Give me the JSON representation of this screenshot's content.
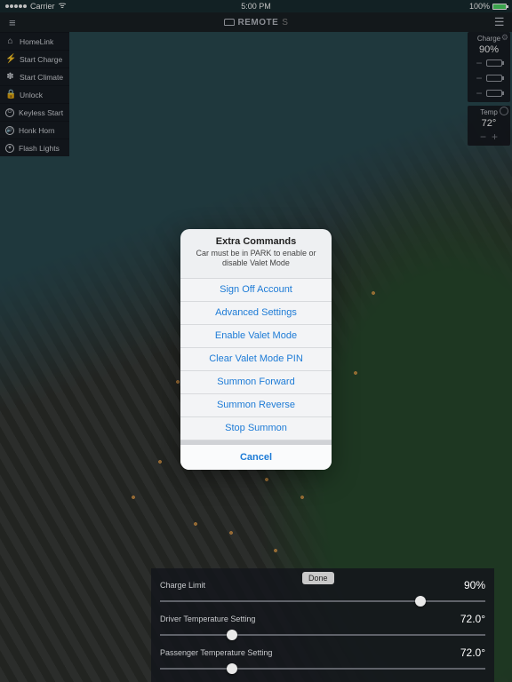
{
  "status_bar": {
    "carrier": "Carrier",
    "time": "5:00 PM",
    "battery_pct": "100%"
  },
  "app_bar": {
    "title_brand": "REMOTE",
    "title_suffix": "S"
  },
  "left_actions": [
    {
      "icon": "home-icon",
      "glyph": "⌂",
      "label": "HomeLink"
    },
    {
      "icon": "bolt-icon",
      "glyph": "⚡",
      "label": "Start Charge"
    },
    {
      "icon": "fan-icon",
      "glyph": "✽",
      "label": "Start Climate"
    },
    {
      "icon": "lock-icon",
      "glyph": "🔒",
      "label": "Unlock"
    },
    {
      "icon": "power-icon",
      "glyph": "⏻",
      "label": "Keyless Start"
    },
    {
      "icon": "horn-icon",
      "glyph": "◉",
      "label": "Honk Horn"
    },
    {
      "icon": "flash-icon",
      "glyph": "◓",
      "label": "Flash Lights"
    }
  ],
  "right_status": {
    "charge_label": "Charge",
    "charge_value": "90%",
    "temp_label": "Temp",
    "temp_value": "72°"
  },
  "action_sheet": {
    "title": "Extra Commands",
    "subtitle": "Car must be in PARK to enable or disable Valet Mode",
    "options": [
      "Sign Off Account",
      "Advanced Settings",
      "Enable Valet Mode",
      "Clear Valet Mode PIN",
      "Summon Forward",
      "Summon Reverse",
      "Stop Summon"
    ],
    "cancel": "Cancel"
  },
  "bottom_panel": {
    "done": "Done",
    "rows": [
      {
        "label": "Charge Limit",
        "value": "90%",
        "pos": 0.8
      },
      {
        "label": "Driver Temperature Setting",
        "value": "72.0°",
        "pos": 0.22
      },
      {
        "label": "Passenger Temperature Setting",
        "value": "72.0°",
        "pos": 0.22
      }
    ]
  }
}
